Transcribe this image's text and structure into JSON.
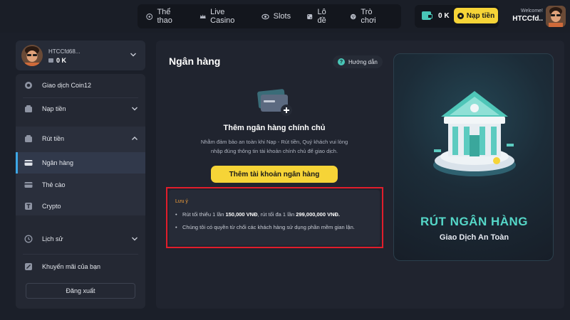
{
  "nav": {
    "items": [
      {
        "label": "Thể thao",
        "icon": "soccer-ball-icon"
      },
      {
        "label": "Live Casino",
        "icon": "crown-icon"
      },
      {
        "label": "Slots",
        "icon": "eye-icon"
      },
      {
        "label": "Lô đề",
        "icon": "dice-icon"
      },
      {
        "label": "Trò chơi",
        "icon": "gamepad-icon"
      }
    ]
  },
  "wallet": {
    "balance": "0 K",
    "deposit_label": "Nạp tiền"
  },
  "welcome": {
    "greeting": "Welcome!",
    "username": "HTCCfd.."
  },
  "user_card": {
    "name": "HTCCfd68...",
    "balance": "0 K"
  },
  "menu": {
    "items": [
      {
        "label": "Giao dịch Coin12",
        "icon": "coin-icon"
      },
      {
        "label": "Nạp tiền",
        "icon": "deposit-icon"
      },
      {
        "label": "Rút tiền",
        "icon": "withdraw-icon"
      },
      {
        "label": "Ngân hàng",
        "icon": "bank-card-icon"
      },
      {
        "label": "Thẻ cào",
        "icon": "scratch-card-icon"
      },
      {
        "label": "Crypto",
        "icon": "crypto-icon"
      },
      {
        "label": "Lịch sử",
        "icon": "history-icon"
      },
      {
        "label": "Khuyến mãi của bạn",
        "icon": "promotion-icon"
      }
    ],
    "logout_label": "Đăng xuất"
  },
  "main": {
    "title": "Ngân hàng",
    "guide_label": "Hướng dẫn",
    "add_title": "Thêm ngân hàng chính chủ",
    "add_desc_1": "Nhằm đảm bảo an toàn khi Nạp - Rút tiền, Quý khách vui lòng",
    "add_desc_2": "nhập đúng thông tin tài khoản chính chủ để giao dịch.",
    "add_button": "Thêm tài khoản ngân hàng",
    "note": {
      "title": "Lưu ý",
      "line1_a": "Rút tối thiểu 1 lần ",
      "line1_b": "150,000 VNĐ",
      "line1_c": ", rút tối đa 1 lần ",
      "line1_d": "299,000,000 VNĐ.",
      "line2": "Chúng tôi có quyền từ chối các khách hàng sử dụng phần mềm gian lận."
    }
  },
  "promo": {
    "title": "RÚT NGÂN HÀNG",
    "subtitle": "Giao Dịch An Toàn"
  },
  "colors": {
    "accent_yellow": "#f6d437",
    "accent_teal": "#49c6b7",
    "highlight_red": "#e11d2b",
    "active_blue": "#3da7e6"
  }
}
